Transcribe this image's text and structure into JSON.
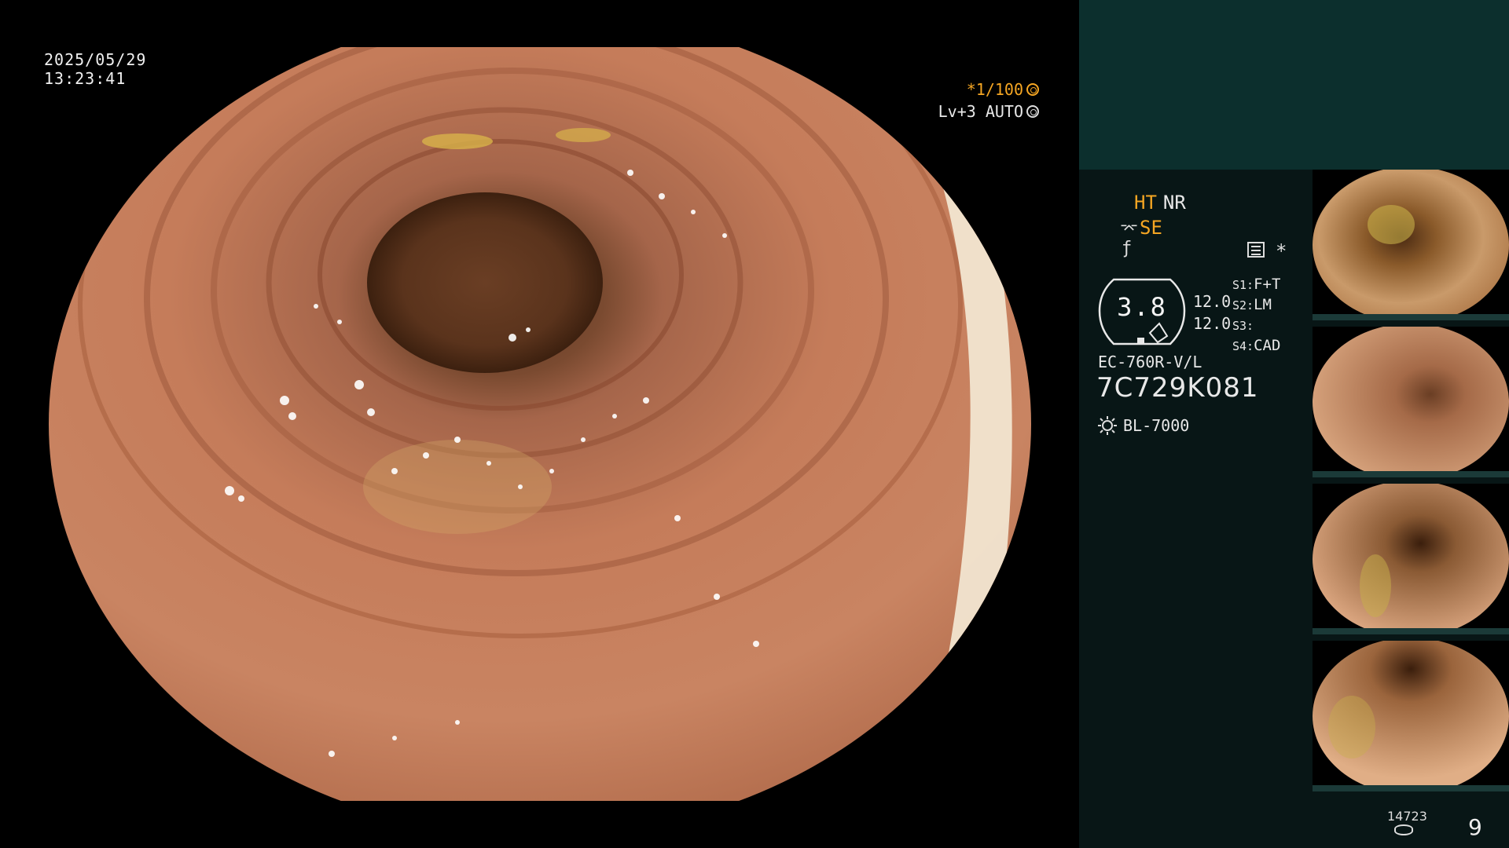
{
  "overlay": {
    "date": "2025/05/29",
    "time": "13:23:41",
    "shutter": "*1/100",
    "level": "Lv+3 AUTO"
  },
  "panel": {
    "enhance_ht": "HT",
    "enhance_nr": "NR",
    "se": "SE",
    "zoom": "3.8",
    "value_a": "12.0",
    "value_b": "12.0",
    "slots": [
      {
        "key": "S1:",
        "value": "F+T"
      },
      {
        "key": "S2:",
        "value": "LM"
      },
      {
        "key": "S3:",
        "value": ""
      },
      {
        "key": "S4:",
        "value": "CAD"
      }
    ],
    "scope_model": "EC-760R-V/L",
    "scope_serial": "7C729K081",
    "light_source": "BL-7000",
    "image_count": "14723",
    "page_number": "9"
  },
  "icons": {
    "shutter": "aperture-icon",
    "level": "auto-iris-icon",
    "se": "scope-icon",
    "fx": "function-icon",
    "menu": "menu-icon",
    "star": "asterisk-icon",
    "light": "sun-icon",
    "storage": "disk-icon"
  },
  "colors": {
    "accent": "#f5a623",
    "panel_bg": "#081616",
    "panel_top": "#0c2f2d",
    "mucosa": "#c27a56"
  }
}
